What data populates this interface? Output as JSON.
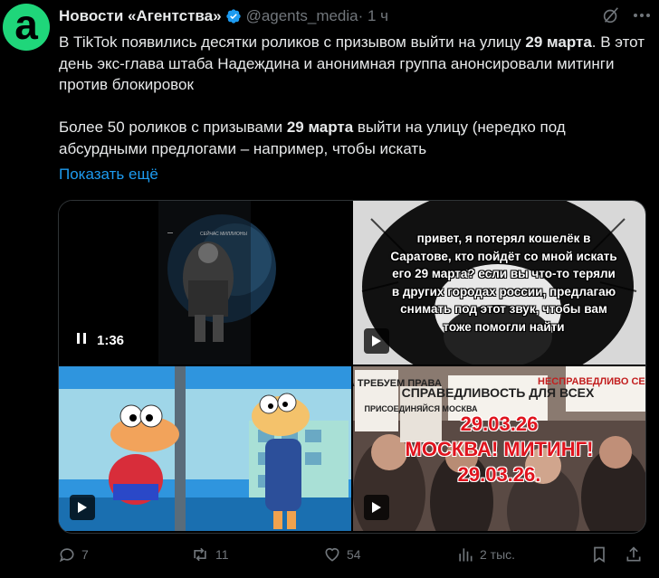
{
  "post": {
    "author_name": "Новости «Агентства»",
    "avatar_letter": "a",
    "handle": "@agents_media",
    "time": " · 1 ч",
    "text_p1_a": "В TikTok появились десятки роликов с призывом выйти на улицу ",
    "text_p1_b": "29 марта",
    "text_p1_c": ". В этот день экс-глава штаба Надеждина и анонимная группа анонсировали митинги против блокировок",
    "text_p2_a": "Более 50 роликов с призывами ",
    "text_p2_b": "29 марта",
    "text_p2_c": " выйти на улицу (нередко под абсурдными предлогами – например, чтобы искать",
    "show_more": "Показать ещё"
  },
  "media": {
    "video1": {
      "duration": "1:36",
      "tiny_caption": "СЕЙЧАС МИЛЛИОНЫ"
    },
    "video2": {
      "caption": "привет, я потерял кошелёк в Саратове, кто пойдёт со мной искать его 29 марта? если вы что-то теряли в других городах россии, предлагаю снимать под этот звук, чтобы вам тоже помогли найти"
    },
    "video4": {
      "sign1": "МОСКВА ТРЕБУЕМ ПРАВА",
      "sign2": "ПРИСОЕДИНЯЙСЯ МОСКВА",
      "sign3": "СПРАВЕДЛИВОСТЬ ДЛЯ ВСЕХ",
      "sign4": "НЕСПРАВЕДЛИВО СЕЙЧАС",
      "overlay_line1": "29.03.26",
      "overlay_line2": "МОСКВА! МИТИНГ!",
      "overlay_line3": "29.03.26."
    }
  },
  "actions": {
    "replies": "7",
    "retweets": "11",
    "likes": "54",
    "views": "2 тыс."
  },
  "colors": {
    "background": "#000000",
    "text": "#e7e9ea",
    "muted": "#71767b",
    "link": "#1d9bf0",
    "verified": "#1d9bf0",
    "avatar": "#1fd67a"
  }
}
